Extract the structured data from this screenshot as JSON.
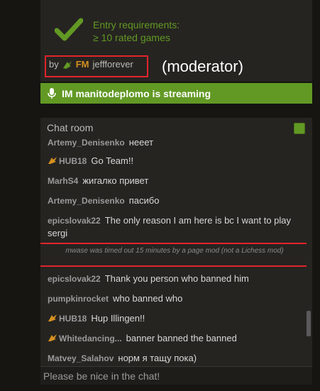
{
  "entry": {
    "line1": "Entry requirements:",
    "line2": "≥ 10 rated games"
  },
  "moderator": {
    "by": "by",
    "title": "FM",
    "name": "jeffforever",
    "annotation": "(moderator)"
  },
  "stream": {
    "label": "IM manitodeplomo is streaming"
  },
  "chat": {
    "title": "Chat room",
    "placeholder": "Please be nice in the chat!",
    "lines": [
      {
        "user": "Artemy_Denisenko",
        "text": "нееет"
      },
      {
        "user": "HUB18",
        "text": "Go Team!!"
      },
      {
        "user": "MarhS4",
        "text": "жигалко привет"
      },
      {
        "user": "Artemy_Denisenko",
        "text": "пасибо"
      },
      {
        "user": "epicslovak22",
        "text": "The only reason I am here is bc I want to play sergi"
      },
      {
        "user": "epicslovak22",
        "text": "Thank you person who banned him"
      },
      {
        "user": "pumpkinrocket",
        "text": "who banned who"
      },
      {
        "user": "HUB18",
        "text": "Hup Illingen!!"
      },
      {
        "user": "Whitedancing...",
        "text": "banner banned the banned"
      },
      {
        "user": "Matvey_Salahov",
        "text": "норм я тащу пока)"
      }
    ],
    "timeout": "mwase was timed out 15 minutes by a page mod (not a Lichess mod)"
  },
  "colors": {
    "accent_green": "#629924",
    "annotation_red": "#e2242b",
    "fm_orange": "#d59020"
  }
}
